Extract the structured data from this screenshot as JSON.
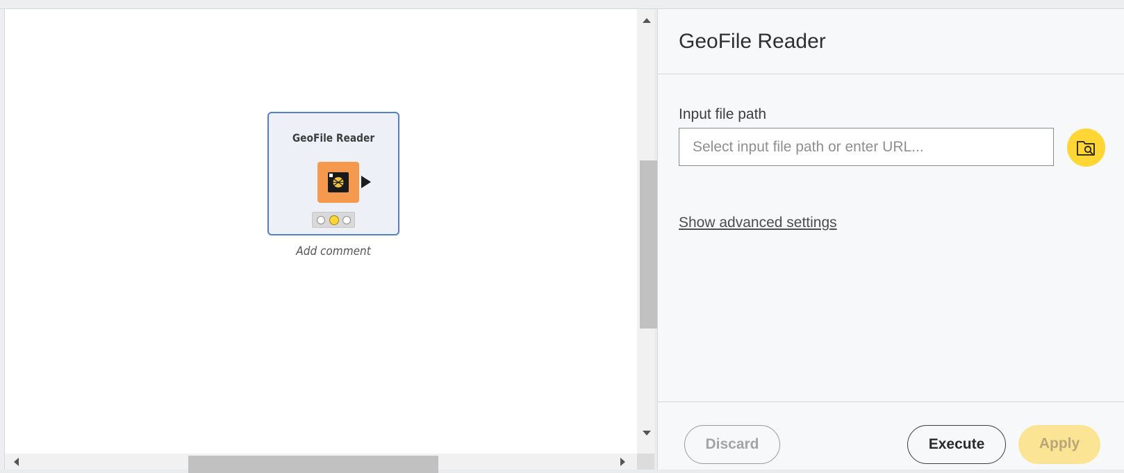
{
  "canvas": {
    "node": {
      "title": "GeoFile Reader",
      "icon": "geofile-reader-node-icon",
      "status": "configured-yellow",
      "comment": "Add comment"
    }
  },
  "panel": {
    "title": "GeoFile Reader",
    "input_label": "Input file path",
    "input_placeholder": "Select input file path or enter URL...",
    "input_value": "",
    "browse_icon": "folder-search-icon",
    "advanced_link": "Show advanced settings",
    "buttons": {
      "discard": "Discard",
      "execute": "Execute",
      "apply": "Apply"
    }
  },
  "colors": {
    "node_border": "#4e82c4",
    "node_icon": "#f5994e",
    "accent_yellow": "#ffd633",
    "apply_disabled": "#fbe595"
  }
}
